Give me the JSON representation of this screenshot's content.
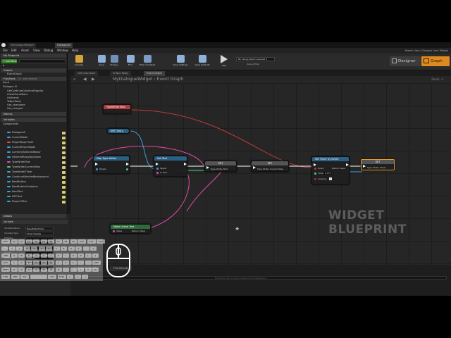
{
  "window": {
    "tabs": [
      "MyDialogueWidget",
      "DialogueUI"
    ],
    "menu": [
      "File",
      "Edit",
      "Asset",
      "View",
      "Debug",
      "Window",
      "Help"
    ],
    "parent_class": "Parent class: Dialogue User Widget"
  },
  "toolbar": {
    "buttons": [
      {
        "label": "Compile",
        "icon": "compile-icon",
        "color": "#d6a33a"
      },
      {
        "label": "Save",
        "icon": "save-icon",
        "color": "#8fb0d8"
      },
      {
        "label": "Browse",
        "icon": "browse-icon",
        "color": "#8fb0d8"
      },
      {
        "label": "Find",
        "icon": "find-icon",
        "color": "#8fb0d8"
      },
      {
        "label": "Hide Unrelated",
        "icon": "hide-unrelated-icon",
        "color": "#8fb0d8"
      },
      {
        "label": "Class Settings",
        "icon": "class-settings-icon",
        "color": "#8fb0d8"
      },
      {
        "label": "Class Defaults",
        "icon": "class-defaults-icon",
        "color": "#8fb0d8"
      },
      {
        "label": "Play",
        "icon": "play-icon",
        "color": "#d6d6d6"
      }
    ],
    "debug_select": "No debug object selected ▾",
    "debug_label": "Debug Filter",
    "designer": "Designer",
    "graph": "Graph",
    "accent_color": "#e08a1e"
  },
  "left": {
    "my_blueprint": "My Blueprint",
    "add_new": "+ Add New ▾",
    "graphs_header": "Graphs",
    "graphs": [
      "EventGraph"
    ],
    "functions_header": "Functions",
    "functions_count": "(17 overridable)",
    "functions": [
      "Input",
      "Dialogue UI"
    ],
    "dialogue_functions": [
      "GetContinueColorAndOpacity",
      "CheckConditions",
      "OnEvents",
      "ToNpcReply",
      "Get_charname",
      "Get_charged"
    ],
    "macros_header": "Macros",
    "variables_header": "Variables",
    "components_header": "Components",
    "variables": [
      {
        "name": "DialogueUI",
        "color": "#3ea5d8"
      },
      {
        "name": "CurrentNode",
        "color": "#3ea5d8"
      },
      {
        "name": "PlayerReplyTimer",
        "color": "#e34a4a"
      },
      {
        "name": "CurrentPlayerNode",
        "color": "#3ea5d8"
      },
      {
        "name": "currentlySelectedReply",
        "color": "#3ea5d8"
      },
      {
        "name": "SelectedReplyKeyDown",
        "color": "#3ea5d8"
      },
      {
        "name": "TypeWriterText",
        "color": "#e34aa6"
      },
      {
        "name": "TypeWriterCurrentStep",
        "color": "#3ed87a"
      },
      {
        "name": "TypeWriterTimer",
        "color": "#3ea5d8"
      },
      {
        "name": "ContinueSelectedBackground",
        "color": "#3ea5d8"
      },
      {
        "name": "NextButton",
        "color": "#3ea5d8"
      },
      {
        "name": "NextButtonContainer",
        "color": "#3ea5d8"
      },
      {
        "name": "NextText",
        "color": "#3ea5d8"
      },
      {
        "name": "NPCText",
        "color": "#3ea5d8"
      },
      {
        "name": "PlayerOffice",
        "color": "#3ea5d8"
      }
    ],
    "details_header": "Details",
    "details_section": "Variable",
    "details_rows": [
      {
        "label": "Variable Name",
        "value": "TypeWriterTimer"
      },
      {
        "label": "Variable Type",
        "value": "Timer Handle"
      },
      {
        "label": "Editable",
        "value": ""
      },
      {
        "label": "Tooltip",
        "value": ""
      },
      {
        "label": "Expose on Spawn",
        "value": ""
      },
      {
        "label": "Private",
        "value": ""
      },
      {
        "label": "Category",
        "value": "Default"
      },
      {
        "label": "Replication",
        "value": "None"
      },
      {
        "label": "Replication Cond.",
        "value": "None"
      }
    ]
  },
  "graph": {
    "tabs": [
      "Get Charname",
      "To Npc Reply",
      "Event Graph"
    ],
    "breadcrumb": "MyDialogueWidget  ›  Event Graph",
    "zoom": "Zoom -3",
    "watermark": "WIDGET BLUEPRINT",
    "nodes": [
      {
        "title": "TypeWriterStep",
        "color": "#b23a3a"
      },
      {
        "title": "NPC Text ▸",
        "color": "#2a5f86"
      },
      {
        "title": "Map Type Writer",
        "color": "#2a5f86",
        "pins": [
          "Target",
          "Len"
        ]
      },
      {
        "title": "Set Text",
        "color": "#2a5f86",
        "pins": [
          "Target",
          "In Text"
        ]
      },
      {
        "title": "Make Literal Text",
        "color": "#2f6b3a",
        "pins": [
          "Value",
          "Return Value"
        ]
      },
      {
        "title": "SET",
        "color": "#555555",
        "pins": [
          "Type Writer Text"
        ]
      },
      {
        "title": "SET",
        "color": "#555555",
        "pins": [
          "Type Writer Current Step"
        ]
      },
      {
        "title": "Set Timer by Event",
        "color": "#2a5f86",
        "pins": [
          "Event",
          "Time",
          "Looping",
          "Return Value"
        ]
      },
      {
        "title": "SET",
        "color": "#555555",
        "pins": [
          "Type Writer Timer"
        ]
      }
    ],
    "time_value": "0.075"
  },
  "bottom": {
    "tabs": [
      "Compiler Results",
      "Find Results"
    ],
    "search_placeholder": "Enter function or event name to find references..."
  },
  "keyboard": {
    "rows": [
      [
        "ESC",
        "F1",
        "F2",
        "F3",
        "F4",
        "F5",
        "F6",
        "F7",
        "F8",
        "F9",
        "F10",
        "F11",
        "F12"
      ],
      [
        "~",
        "1",
        "2",
        "3",
        "4",
        "5",
        "6",
        "7",
        "8",
        "9",
        "0",
        "-",
        "="
      ],
      [
        "TAB",
        "Q",
        "W",
        "E",
        "R",
        "T",
        "Y",
        "U",
        "I",
        "O",
        "P",
        "[",
        "]"
      ],
      [
        "CAPS",
        "A",
        "S",
        "D",
        "F",
        "G",
        "H",
        "J",
        "K",
        "L",
        ";",
        "'",
        "ENT"
      ],
      [
        "SHIFT",
        "Z",
        "X",
        "C",
        "V",
        "B",
        "N",
        "M",
        ",",
        ".",
        "/",
        "↑",
        "SH"
      ],
      [
        "CTRL",
        "WIN",
        "ALT",
        "",
        "ALT",
        "CTRL",
        "←",
        "↓",
        "→"
      ]
    ]
  }
}
